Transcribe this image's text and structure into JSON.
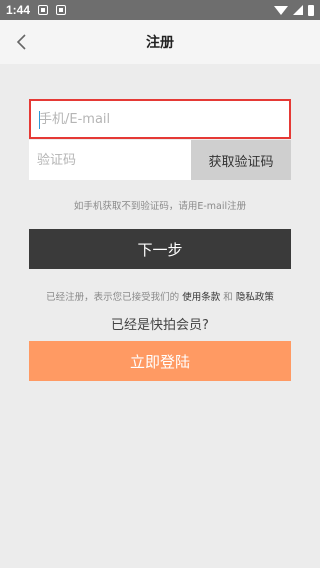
{
  "status_bar": {
    "time": "1:44"
  },
  "header": {
    "title": "注册"
  },
  "form": {
    "phone_placeholder": "手机/E-mail",
    "code_placeholder": "验证码",
    "get_code_label": "获取验证码"
  },
  "hint": "如手机获取不到验证码，请用E-mail注册",
  "next_label": "下一步",
  "agreement": {
    "prefix": "已经注册，表示您已接受我们的",
    "terms": "使用条款",
    "and": "和",
    "privacy": "隐私政策"
  },
  "member_text": "已经是快拍会员?",
  "login_label": "立即登陆",
  "colors": {
    "accent": "#ff9a63",
    "dark_button": "#3a3a3a",
    "highlight_border": "#e53935",
    "caret": "#2e9bd6"
  }
}
